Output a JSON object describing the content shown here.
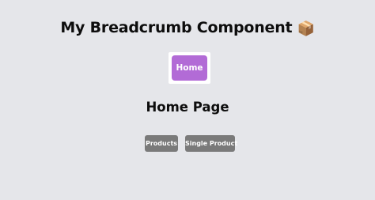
{
  "header": {
    "title": "My Breadcrumb Component",
    "emoji": "📦"
  },
  "breadcrumb": {
    "items": [
      {
        "label": "Home",
        "color": "#b26bd6"
      }
    ]
  },
  "main": {
    "heading": "Home Page",
    "buttons": [
      {
        "label": "Products"
      },
      {
        "label": "Single Product"
      }
    ],
    "button_color": "#7a7a7a"
  },
  "theme": {
    "background": "#e5e6ea"
  }
}
